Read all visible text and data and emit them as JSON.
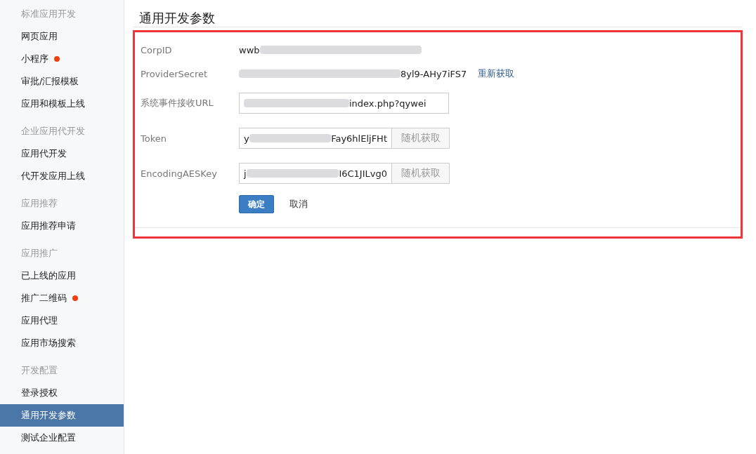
{
  "sidebar": {
    "groups": [
      {
        "heading": "标准应用开发",
        "items": [
          {
            "label": "网页应用",
            "selected": false,
            "badge": false
          },
          {
            "label": "小程序",
            "selected": false,
            "badge": true
          },
          {
            "label": "审批/汇报模板",
            "selected": false,
            "badge": false
          },
          {
            "label": "应用和模板上线",
            "selected": false,
            "badge": false
          }
        ]
      },
      {
        "heading": "企业应用代开发",
        "items": [
          {
            "label": "应用代开发",
            "selected": false,
            "badge": false
          },
          {
            "label": "代开发应用上线",
            "selected": false,
            "badge": false
          }
        ]
      },
      {
        "heading": "应用推荐",
        "items": [
          {
            "label": "应用推荐申请",
            "selected": false,
            "badge": false
          }
        ]
      },
      {
        "heading": "应用推广",
        "items": [
          {
            "label": "已上线的应用",
            "selected": false,
            "badge": false
          },
          {
            "label": "推广二维码",
            "selected": false,
            "badge": true
          },
          {
            "label": "应用代理",
            "selected": false,
            "badge": false
          },
          {
            "label": "应用市场搜索",
            "selected": false,
            "badge": false
          }
        ]
      },
      {
        "heading": "开发配置",
        "items": [
          {
            "label": "登录授权",
            "selected": false,
            "badge": false
          },
          {
            "label": "通用开发参数",
            "selected": true,
            "badge": false
          },
          {
            "label": "测试企业配置",
            "selected": false,
            "badge": false
          }
        ]
      }
    ]
  },
  "page": {
    "title": "通用开发参数"
  },
  "form": {
    "rows": [
      {
        "kind": "text",
        "label": "CorpID",
        "value_start": "wwb",
        "blurred": true,
        "value_end": ""
      },
      {
        "kind": "text",
        "label": "ProviderSecret",
        "value_start": "",
        "blurred": true,
        "value_end": "8yl9-AHy7iFS7",
        "action": "重新获取"
      },
      {
        "kind": "field",
        "label": "系统事件接收URL",
        "value_start": "",
        "blurred": true,
        "value_end": "index.php?qywei"
      },
      {
        "kind": "field",
        "label": "Token",
        "value_start": "y",
        "blurred": true,
        "value_end": "Fay6hlEljFHt",
        "action": "随机获取"
      },
      {
        "kind": "field",
        "label": "EncodingAESKey",
        "value_start": "j",
        "blurred": true,
        "value_end": "I6C1JILvg0",
        "action": "随机获取"
      }
    ],
    "confirm": "确定",
    "cancel": "取消"
  },
  "annotation": {
    "highlighted": true
  }
}
